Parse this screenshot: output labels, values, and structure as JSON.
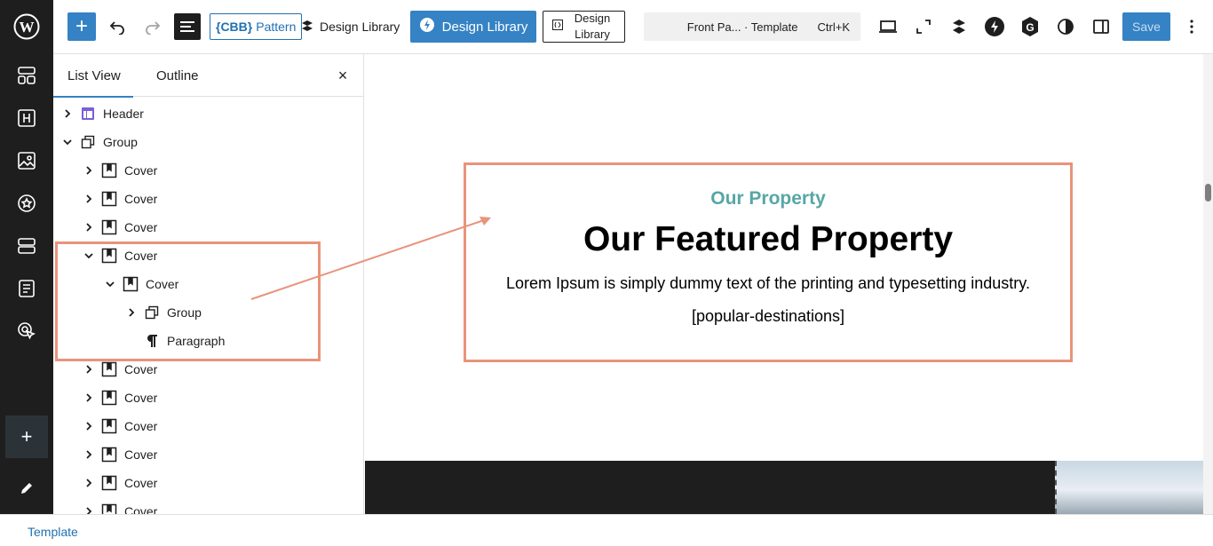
{
  "toolbar": {
    "add_label": "+",
    "pattern_prefix": "{CBB}",
    "pattern_label": "Pattern",
    "design_library_1": "Design Library",
    "design_library_2": "Design Library",
    "design_library_3": "Design Library",
    "command_title": "Front Pa... · Template",
    "command_shortcut": "Ctrl+K",
    "save_label": "Save"
  },
  "panel": {
    "tabs": [
      {
        "label": "List View",
        "active": true
      },
      {
        "label": "Outline",
        "active": false
      }
    ],
    "close_label": "×",
    "items": [
      {
        "label": "Header",
        "level": 0,
        "chevron": "right",
        "icon": "template-part-icon"
      },
      {
        "label": "Group",
        "level": 0,
        "chevron": "down",
        "icon": "group-icon"
      },
      {
        "label": "Cover",
        "level": 1,
        "chevron": "right",
        "icon": "cover-icon"
      },
      {
        "label": "Cover",
        "level": 1,
        "chevron": "right",
        "icon": "cover-icon"
      },
      {
        "label": "Cover",
        "level": 1,
        "chevron": "right",
        "icon": "cover-icon"
      },
      {
        "label": "Cover",
        "level": 1,
        "chevron": "down",
        "icon": "cover-icon"
      },
      {
        "label": "Cover",
        "level": 2,
        "chevron": "down",
        "icon": "cover-icon"
      },
      {
        "label": "Group",
        "level": 3,
        "chevron": "right",
        "icon": "group-icon"
      },
      {
        "label": "Paragraph",
        "level": 3,
        "chevron": "none",
        "icon": "paragraph-icon"
      },
      {
        "label": "Cover",
        "level": 1,
        "chevron": "right",
        "icon": "cover-icon"
      },
      {
        "label": "Cover",
        "level": 1,
        "chevron": "right",
        "icon": "cover-icon"
      },
      {
        "label": "Cover",
        "level": 1,
        "chevron": "right",
        "icon": "cover-icon"
      },
      {
        "label": "Cover",
        "level": 1,
        "chevron": "right",
        "icon": "cover-icon"
      },
      {
        "label": "Cover",
        "level": 1,
        "chevron": "right",
        "icon": "cover-icon"
      },
      {
        "label": "Cover",
        "level": 1,
        "chevron": "right",
        "icon": "cover-icon"
      }
    ]
  },
  "canvas": {
    "eyebrow": "Our Property",
    "headline": "Our Featured Property",
    "description": "Lorem Ipsum is simply dummy text of the printing and typesetting industry.",
    "shortcode": "[popular-destinations]"
  },
  "footer": {
    "breadcrumb": "Template"
  },
  "colors": {
    "accent": "#3582c4",
    "highlight": "#e9937b",
    "eyebrow": "#58a6a6",
    "rail": "#1e1e1e"
  }
}
